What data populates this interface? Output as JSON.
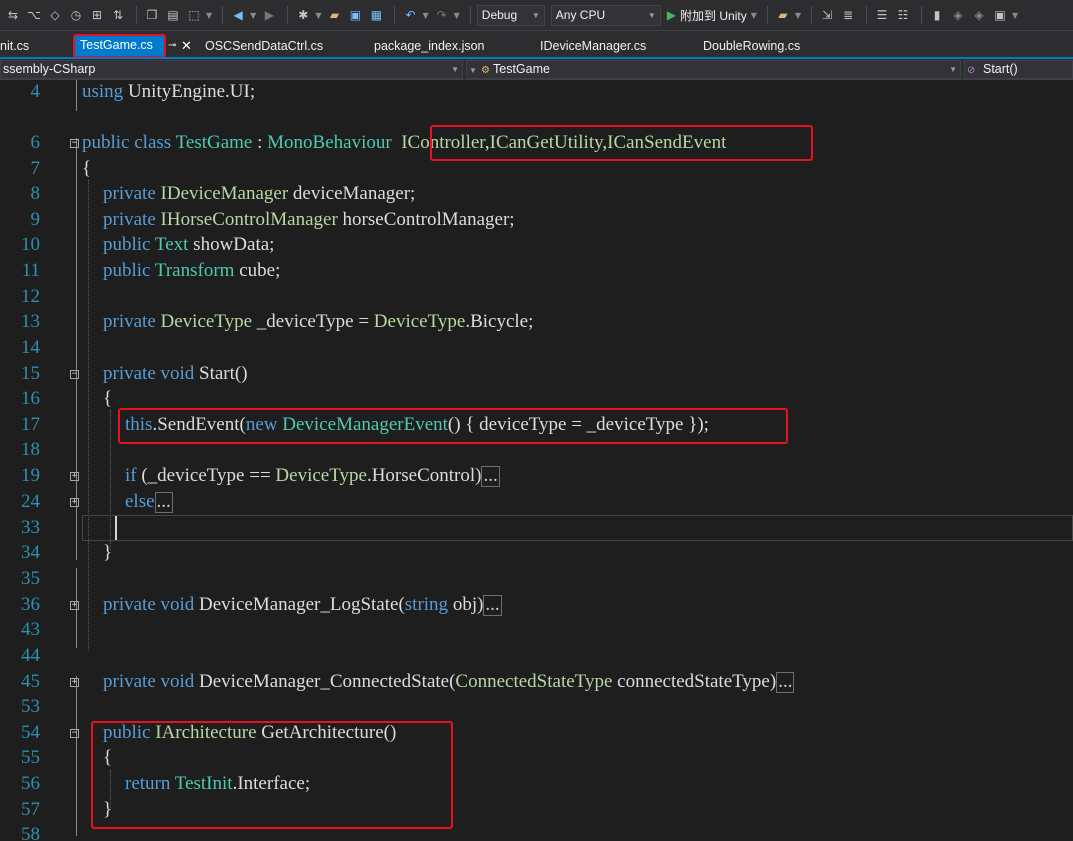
{
  "toolbar": {
    "config": "Debug",
    "platform": "Any CPU",
    "attach": "附加到 Unity"
  },
  "tabs": [
    {
      "label": "nit.cs"
    },
    {
      "label": "TestGame.cs"
    },
    {
      "label": "OSCSendDataCtrl.cs"
    },
    {
      "label": "package_index.json"
    },
    {
      "label": "IDeviceManager.cs"
    },
    {
      "label": "DoubleRowing.cs"
    }
  ],
  "nav": {
    "project": "ssembly-CSharp",
    "class": "TestGame",
    "member": "Start()"
  },
  "code": {
    "ln": [
      "4",
      "6",
      "7",
      "8",
      "9",
      "10",
      "11",
      "12",
      "13",
      "14",
      "15",
      "16",
      "17",
      "18",
      "19",
      "24",
      "33",
      "34",
      "35",
      "36",
      "43",
      "44",
      "45",
      "53",
      "54",
      "55",
      "56",
      "57",
      "58"
    ],
    "l4": [
      "using",
      " UnityEngine.UI;"
    ],
    "l6": [
      "public class",
      " ",
      "TestGame",
      " : ",
      "MonoBehaviour",
      "  ",
      "IController",
      ",",
      "ICanGetUtility",
      ",",
      "ICanSendEvent"
    ],
    "l7": "{",
    "l8": [
      "private",
      " ",
      "IDeviceManager",
      " deviceManager;"
    ],
    "l9": [
      "private",
      " ",
      "IHorseControlManager",
      " horseControlManager;"
    ],
    "l10": [
      "public",
      " ",
      "Text",
      " showData;"
    ],
    "l11": [
      "public",
      " ",
      "Transform",
      " cube;"
    ],
    "l13": [
      "private",
      " ",
      "DeviceType",
      " _deviceType = ",
      "DeviceType",
      ".Bicycle;"
    ],
    "l15": [
      "private void",
      " Start()"
    ],
    "l16": "{",
    "l17": [
      "this",
      ".SendEvent(",
      "new",
      " ",
      "DeviceManagerEvent",
      "() { deviceType = _deviceType });"
    ],
    "l19": [
      "if",
      " (_deviceType == ",
      "DeviceType",
      ".HorseControl)"
    ],
    "l24": [
      "else"
    ],
    "l34": "}",
    "l36": [
      "private void",
      " DeviceManager_LogState(",
      "string",
      " obj)"
    ],
    "l45": [
      "private void",
      " DeviceManager_ConnectedState(",
      "ConnectedStateType",
      " connectedStateType)"
    ],
    "l54": [
      "public",
      " ",
      "IArchitecture",
      " GetArchitecture()"
    ],
    "l55": "{",
    "l56": [
      "return",
      " ",
      "TestInit",
      ".Interface;"
    ],
    "l57": "}",
    "ellipsis": "..."
  },
  "colors": {
    "keyword": "#569cd6",
    "type": "#4ec9b0",
    "interface": "#b8d7a3",
    "line_number": "#2b91af",
    "highlight": "#e81123"
  }
}
